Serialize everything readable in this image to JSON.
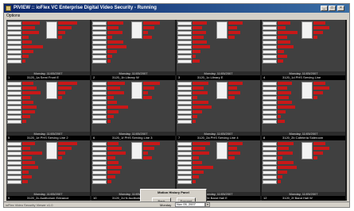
{
  "window": {
    "title": "PIVIEW :: ioFlex VC Enterprise Digital Video Security - Running"
  },
  "menubar": {
    "item": "Options"
  },
  "cameras": [
    {
      "num": "1",
      "name": "3120_1a Semi Front E",
      "date": "Monday, 11/05/2007"
    },
    {
      "num": "2",
      "name": "3120_1b Library W",
      "date": "Monday, 11/05/2007"
    },
    {
      "num": "3",
      "name": "3120_1c Library E",
      "date": "Monday, 11/05/2007"
    },
    {
      "num": "4",
      "name": "3120_1d PHS Serving Line",
      "date": "Monday, 11/05/2007"
    },
    {
      "num": "5",
      "name": "3120_1e PHS Serving Line 2",
      "date": "Monday, 11/05/2007"
    },
    {
      "num": "6",
      "name": "3120_1f PHS Serving Line 3",
      "date": "Monday, 11/05/2007"
    },
    {
      "num": "7",
      "name": "3120_2a PHS Serving Line 4",
      "date": "Monday, 11/05/2007"
    },
    {
      "num": "8",
      "name": "3120_2b Cafeteria Sideroom",
      "date": "Monday, 11/05/2007"
    },
    {
      "num": "9",
      "name": "3120_2c Auditorium Entrance",
      "date": "Monday, 11/05/2007"
    },
    {
      "num": "10",
      "name": "3120_2d N Auditorium",
      "date": "Monday, 11/05/2007"
    },
    {
      "num": "11",
      "name": "3120_2e Band Hall E",
      "date": "Monday, 11/05/2007"
    },
    {
      "num": "12",
      "name": "3120_2f Band Hall W",
      "date": "Monday, 11/05/2007"
    }
  ],
  "dialog": {
    "title": "Motion History Panel",
    "back_label": "Back",
    "forward_label": "Forward"
  },
  "statusbar": {
    "left_text": "ioFlex Video Security Viewer v1.0",
    "day": "Monday",
    "date": "Nov 05, 2007",
    "dropdown_icon": "chevron-down-icon"
  },
  "colors": {
    "motion_bar": "#c81818",
    "title_gradient_start": "#0a246a"
  }
}
